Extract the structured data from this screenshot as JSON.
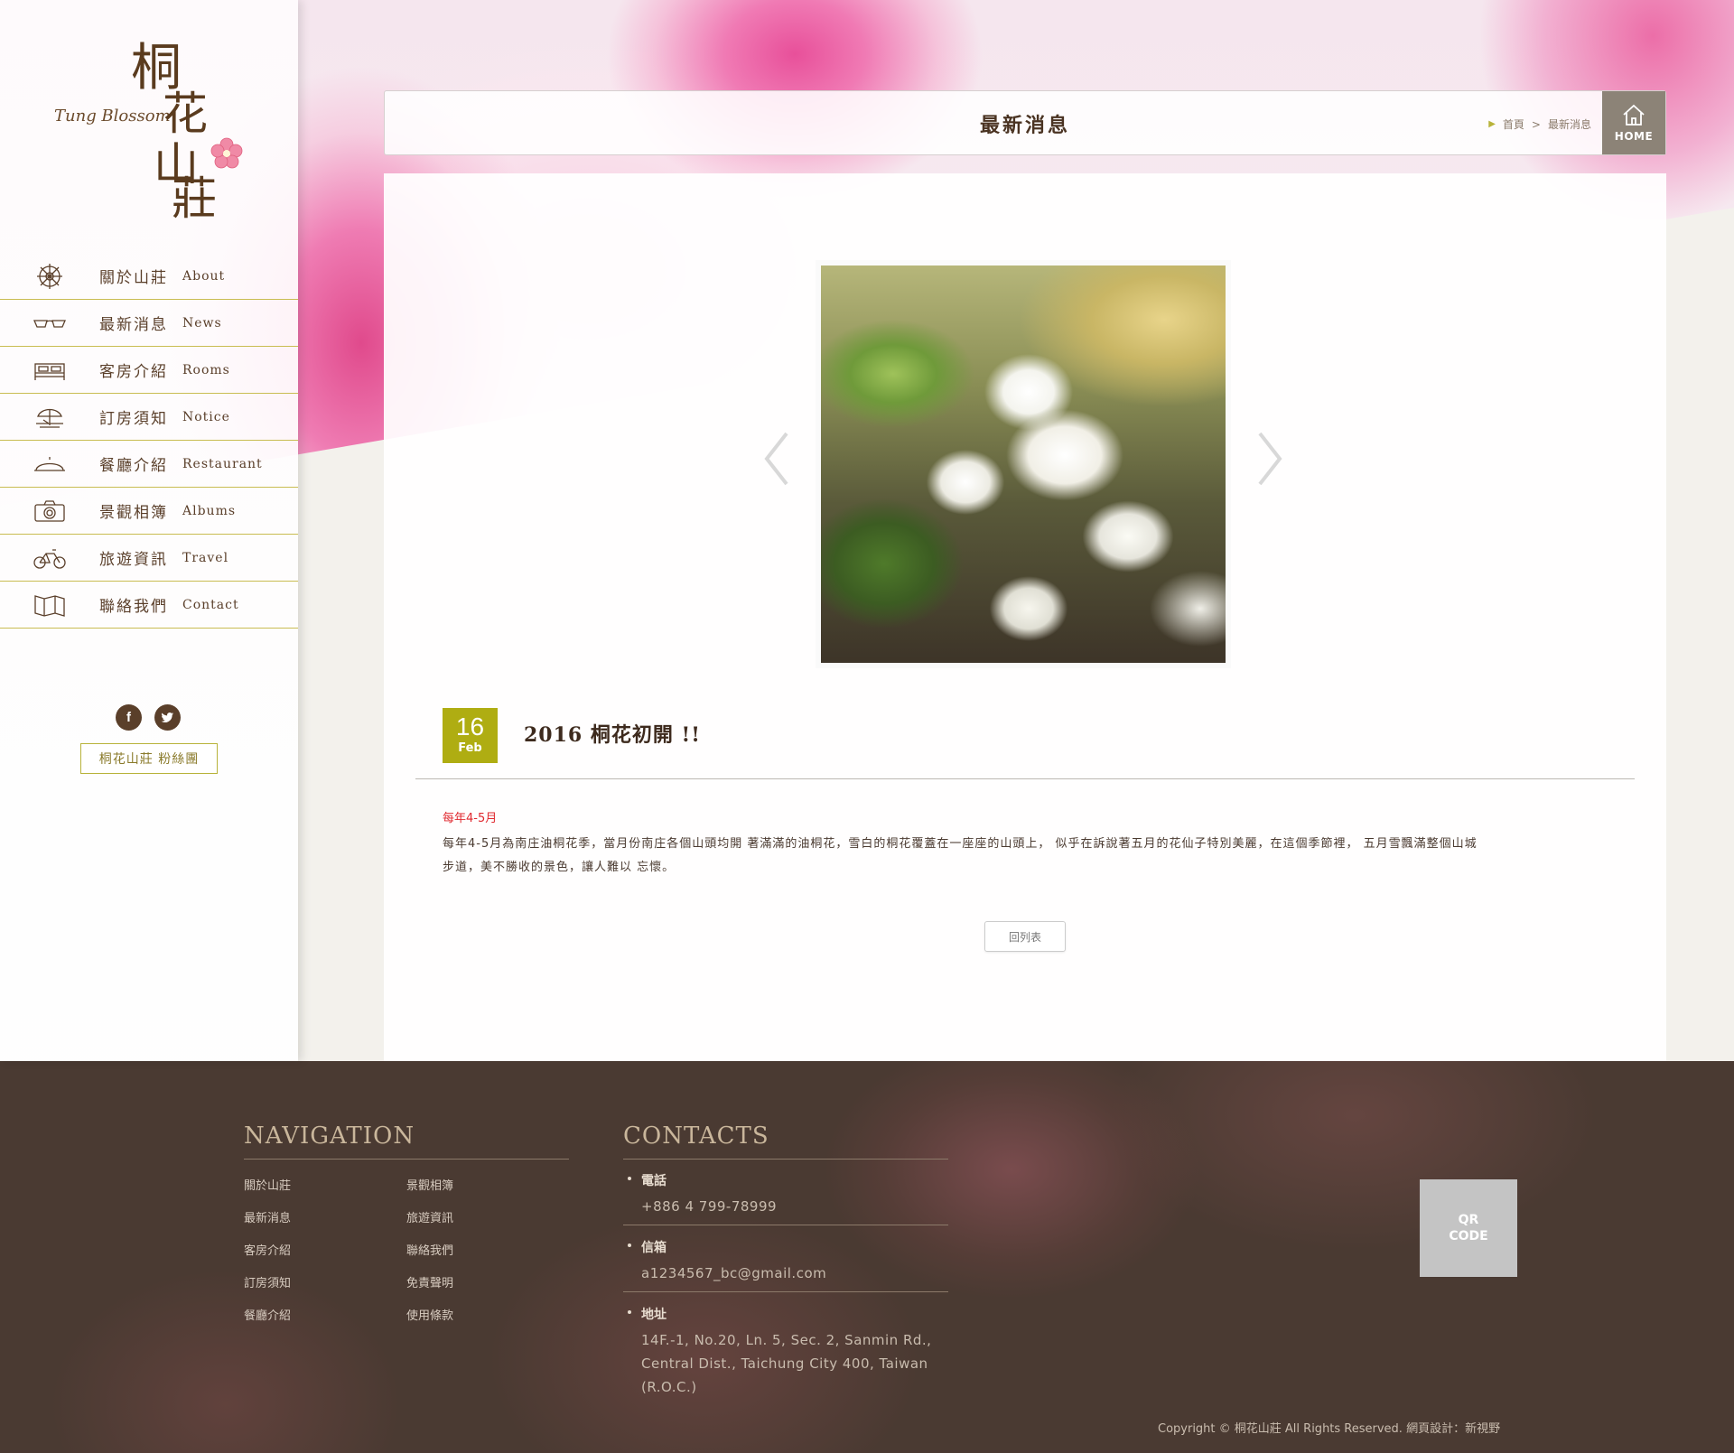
{
  "brand": {
    "name_en": "Tung Blossom",
    "name_zh_1": "桐",
    "name_zh_2": "花",
    "name_zh_3": "山",
    "name_zh_4": "莊"
  },
  "sidebar": {
    "items": [
      {
        "zh": "關於山莊",
        "en": "About",
        "icon": "wheel-icon"
      },
      {
        "zh": "最新消息",
        "en": "News",
        "icon": "glasses-icon"
      },
      {
        "zh": "客房介紹",
        "en": "Rooms",
        "icon": "bed-icon"
      },
      {
        "zh": "訂房須知",
        "en": "Notice",
        "icon": "beach-umbrella-icon"
      },
      {
        "zh": "餐廳介紹",
        "en": "Restaurant",
        "icon": "cloche-icon"
      },
      {
        "zh": "景觀相簿",
        "en": "Albums",
        "icon": "camera-icon"
      },
      {
        "zh": "旅遊資訊",
        "en": "Travel",
        "icon": "bicycle-icon"
      },
      {
        "zh": "聯絡我們",
        "en": "Contact",
        "icon": "map-icon"
      }
    ],
    "social": {
      "facebook": "f",
      "twitter": "t"
    },
    "fan_button": "桐花山莊 粉絲團"
  },
  "header": {
    "title": "最新消息",
    "breadcrumb": {
      "home": "首頁",
      "separator": ">",
      "current": "最新消息"
    },
    "home_label": "HOME"
  },
  "post": {
    "day": "16",
    "month": "Feb",
    "title": "2016 桐花初開 !!",
    "lead": "每年4-5月",
    "body_line1": "每年4-5月為南庄油桐花季，當月份南庄各個山頭均開 著滿滿的油桐花，雪白的桐花覆蓋在一座座的山頭上， 似乎在訴說著五月的花仙子特別美麗，在這個季節裡， 五月雪飄滿整個山城",
    "body_line2": "步道，美不勝收的景色，讓人難以 忘懷。",
    "back_label": "回列表"
  },
  "footer": {
    "nav_title": "NAVIGATION",
    "nav_links": [
      "關於山莊",
      "最新消息",
      "客房介紹",
      "訂房須知",
      "餐廳介紹",
      "景觀相簿",
      "旅遊資訊",
      "聯絡我們",
      "免責聲明",
      "使用條款"
    ],
    "contacts_title": "CONTACTS",
    "phone_label": "電話",
    "phone": "+886 4 799-78999",
    "email_label": "信箱",
    "email": "a1234567_bc@gmail.com",
    "address_label": "地址",
    "address_line1": "14F.-1, No.20, Ln. 5, Sec. 2, Sanmin Rd.,",
    "address_line2": "Central Dist., Taichung City 400, Taiwan",
    "address_line3": "(R.O.C.)",
    "qr_line1": "QR",
    "qr_line2": "CODE",
    "copyright": "Copyright © 桐花山莊 All Rights Reserved.  網頁設計：新視野"
  },
  "colors": {
    "accent_olive": "#afad12",
    "brand_brown": "#5a3f2a",
    "footer_bg": "#4a3a32",
    "lead_red": "#e0282e"
  }
}
